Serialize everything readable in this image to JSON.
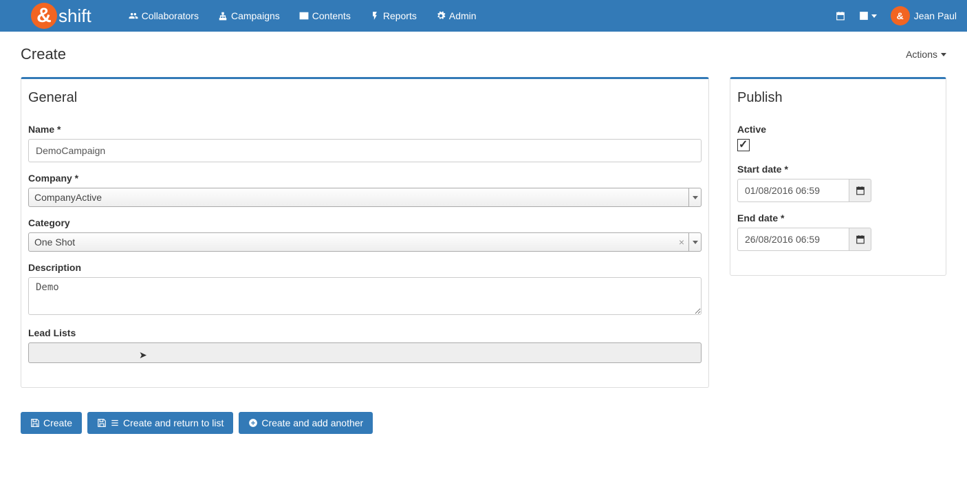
{
  "navbar": {
    "brand": "shift",
    "items": [
      {
        "label": "Collaborators",
        "icon": "users"
      },
      {
        "label": "Campaigns",
        "icon": "sitemap"
      },
      {
        "label": "Contents",
        "icon": "envelope"
      },
      {
        "label": "Reports",
        "icon": "bolt"
      },
      {
        "label": "Admin",
        "icon": "gear"
      }
    ],
    "user_name": "Jean Paul"
  },
  "page": {
    "title": "Create",
    "actions_label": "Actions"
  },
  "general": {
    "title": "General",
    "name_label": "Name *",
    "name_value": "DemoCampaign",
    "company_label": "Company *",
    "company_value": "CompanyActive",
    "category_label": "Category",
    "category_value": "One Shot",
    "description_label": "Description",
    "description_value": "Demo",
    "leadlists_label": "Lead Lists"
  },
  "publish": {
    "title": "Publish",
    "active_label": "Active",
    "active_checked": true,
    "start_date_label": "Start date *",
    "start_date_value": "01/08/2016 06:59",
    "end_date_label": "End date *",
    "end_date_value": "26/08/2016 06:59"
  },
  "buttons": {
    "create": "Create",
    "create_return": "Create and return to list",
    "create_another": "Create and add another"
  }
}
